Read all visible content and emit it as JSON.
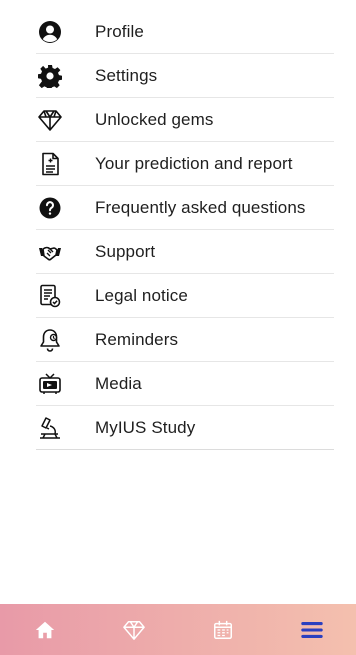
{
  "menu": {
    "items": [
      {
        "label": "Profile",
        "icon": "profile-icon"
      },
      {
        "label": "Settings",
        "icon": "gear-icon"
      },
      {
        "label": "Unlocked gems",
        "icon": "gem-icon"
      },
      {
        "label": "Your prediction and report",
        "icon": "report-icon"
      },
      {
        "label": "Frequently asked questions",
        "icon": "question-icon"
      },
      {
        "label": "Support",
        "icon": "handshake-icon"
      },
      {
        "label": "Legal notice",
        "icon": "legal-notice-icon"
      },
      {
        "label": "Reminders",
        "icon": "bell-icon"
      },
      {
        "label": "Media",
        "icon": "tv-icon"
      },
      {
        "label": "MyIUS Study",
        "icon": "microscope-icon"
      }
    ]
  },
  "bottom_nav": {
    "items": [
      {
        "icon": "home-icon"
      },
      {
        "icon": "gem-icon"
      },
      {
        "icon": "calendar-icon"
      },
      {
        "icon": "menu-icon",
        "active": true
      }
    ]
  },
  "colors": {
    "nav_gradient_left": "#e89aa8",
    "nav_gradient_right": "#f4c0ae",
    "nav_icon": "#ffffff",
    "nav_active": "#2b3fbf",
    "text": "#1f1f1f",
    "icon": "#111111"
  }
}
